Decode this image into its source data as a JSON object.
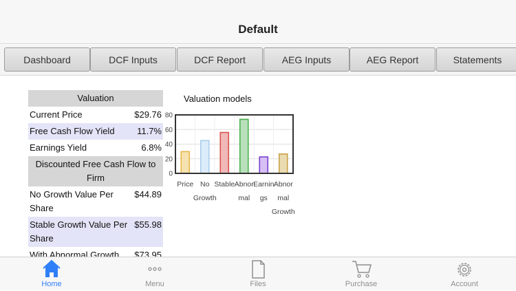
{
  "header": {
    "title": "Default"
  },
  "tabs": [
    {
      "label": "Dashboard"
    },
    {
      "label": "DCF Inputs"
    },
    {
      "label": "DCF Report"
    },
    {
      "label": "AEG Inputs"
    },
    {
      "label": "AEG Report"
    },
    {
      "label": "Statements"
    }
  ],
  "valuation": {
    "header": "Valuation",
    "rows": [
      {
        "label": "Current Price",
        "value": "$29.76"
      },
      {
        "label": "Free Cash Flow Yield",
        "value": "11.7%"
      },
      {
        "label": "Earnings Yield",
        "value": "6.8%"
      }
    ],
    "dcf_header": "Discounted Free Cash Flow to Firm",
    "dcf_rows": [
      {
        "label": "No Growth Value Per Share",
        "value": "$44.89"
      },
      {
        "label": "Stable Growth Value Per Share",
        "value": "$55.98"
      },
      {
        "label": "With Abnormal Growth",
        "value": "$73.95"
      }
    ]
  },
  "chart_data": {
    "type": "bar",
    "title": "Valuation models",
    "categories": [
      "Price",
      "No Growth",
      "Stable",
      "Abnormal",
      "Earnings",
      "Abnormal Growth"
    ],
    "category_label_lines": [
      [
        "Price"
      ],
      [
        "No",
        "Growth"
      ],
      [
        "Stable"
      ],
      [
        "Abnor",
        "mal"
      ],
      [
        "Earnin",
        "gs"
      ],
      [
        "Abnor",
        "mal",
        "Growth"
      ]
    ],
    "values": [
      29.76,
      44.89,
      55.98,
      73.95,
      22.5,
      26.5
    ],
    "colors": [
      "#e8b84a",
      "#a9cdec",
      "#d9534f",
      "#4caf50",
      "#7b3fd1",
      "#c9a24a"
    ],
    "fills": [
      "#f6e2b0",
      "#dcecfa",
      "#f1b8b8",
      "#b9e0bb",
      "#d5bff5",
      "#eadbb0"
    ],
    "ylim": [
      0,
      80
    ],
    "yticks": [
      0,
      20,
      40,
      60,
      80
    ],
    "grid": true
  },
  "tabbar": {
    "items": [
      {
        "label": "Home",
        "icon": "home-icon",
        "active": true
      },
      {
        "label": "Menu",
        "icon": "more-icon",
        "active": false
      },
      {
        "label": "Files",
        "icon": "file-icon",
        "active": false
      },
      {
        "label": "Purchase",
        "icon": "cart-icon",
        "active": false
      },
      {
        "label": "Account",
        "icon": "gear-icon",
        "active": false
      }
    ]
  },
  "colors": {
    "accent": "#2f7ff7",
    "highlight_row": "#e4e4f8",
    "header_row": "#d6d6d6"
  }
}
